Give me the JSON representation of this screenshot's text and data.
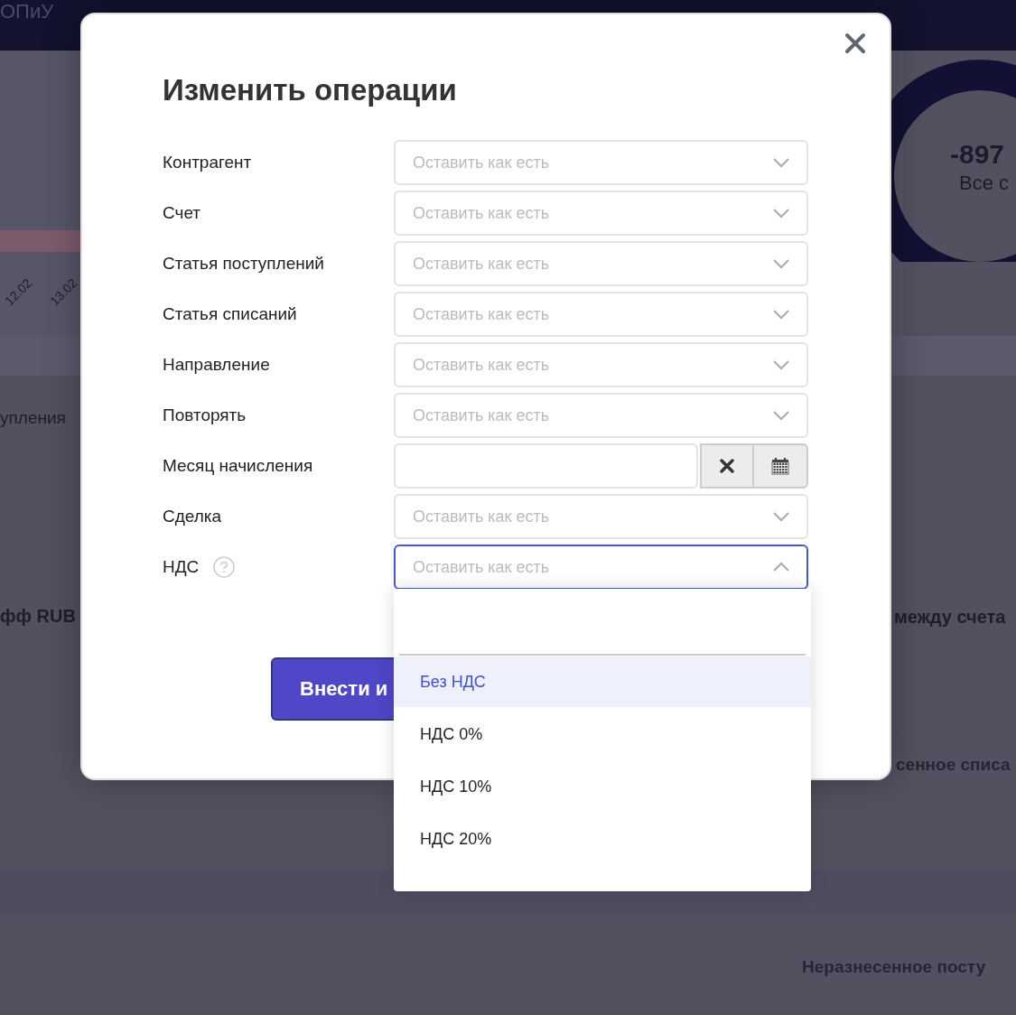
{
  "background": {
    "top_tab": "ОПиУ",
    "chart_ticks": [
      "12.02",
      "13.02"
    ],
    "section_tab": "упления",
    "account_name": "фф RUB",
    "total": {
      "amount": "-897",
      "caption": "Все с"
    },
    "transfer_label": "между счета",
    "write_off_label": "сенное списа",
    "income_label": "Неразнесенное посту"
  },
  "dialog": {
    "title": "Изменить операции",
    "fields": [
      {
        "label": "Контрагент",
        "kind": "select",
        "placeholder": "Оставить как есть",
        "open": false,
        "help": false
      },
      {
        "label": "Счет",
        "kind": "select",
        "placeholder": "Оставить как есть",
        "open": false,
        "help": false
      },
      {
        "label": "Статья поступлений",
        "kind": "select",
        "placeholder": "Оставить как есть",
        "open": false,
        "help": false
      },
      {
        "label": "Статья списаний",
        "kind": "select",
        "placeholder": "Оставить как есть",
        "open": false,
        "help": false
      },
      {
        "label": "Направление",
        "kind": "select",
        "placeholder": "Оставить как есть",
        "open": false,
        "help": false
      },
      {
        "label": "Повторять",
        "kind": "select",
        "placeholder": "Оставить как есть",
        "open": false,
        "help": false
      },
      {
        "label": "Месяц начисления",
        "kind": "date",
        "help": false
      },
      {
        "label": "Сделка",
        "kind": "select",
        "placeholder": "Оставить как есть",
        "open": false,
        "help": false
      },
      {
        "label": "НДС",
        "kind": "select",
        "placeholder": "Оставить как есть",
        "open": true,
        "help": true
      }
    ],
    "submit": "Внести и",
    "dropdown": {
      "options": [
        {
          "label": "Без НДС",
          "selected": true
        },
        {
          "label": "НДС 0%",
          "selected": false
        },
        {
          "label": "НДС 10%",
          "selected": false
        },
        {
          "label": "НДС 20%",
          "selected": false
        }
      ]
    }
  }
}
